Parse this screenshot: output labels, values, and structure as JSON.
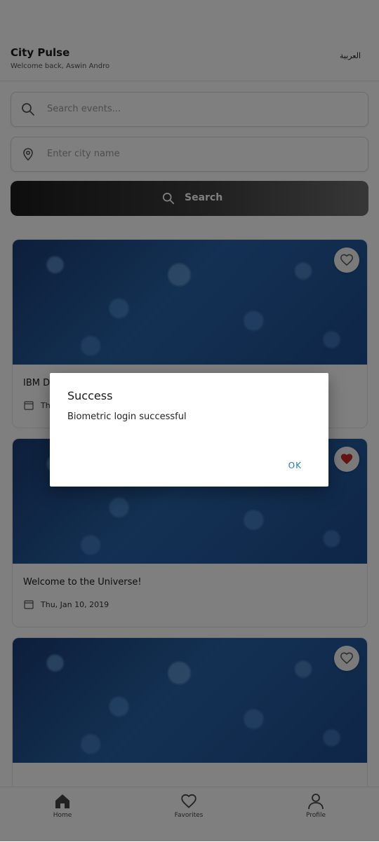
{
  "header": {
    "title": "City Pulse",
    "subtitle": "Welcome back, Aswin Andro",
    "language_toggle": "العربية"
  },
  "search": {
    "events_placeholder": "Search events...",
    "city_placeholder": "Enter city name",
    "button_label": "Search"
  },
  "events": [
    {
      "title": "IBM D",
      "date": "Th",
      "favorited": false
    },
    {
      "title": "Welcome to the Universe!",
      "date": "Thu, Jan 10, 2019",
      "favorited": true
    },
    {
      "title": "",
      "date": "",
      "favorited": false
    }
  ],
  "nav": {
    "home": "Home",
    "favorites": "Favorites",
    "profile": "Profile"
  },
  "dialog": {
    "title": "Success",
    "message": "Biometric login successful",
    "ok": "OK"
  },
  "colors": {
    "accent": "#1e7fa8",
    "favorite_active": "#c62828"
  }
}
